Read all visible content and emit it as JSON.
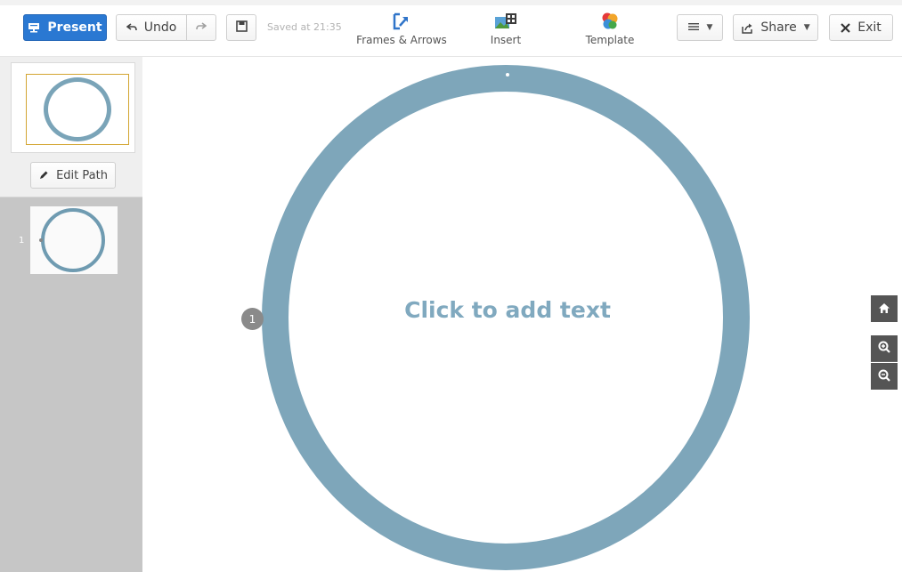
{
  "toolbar": {
    "present_label": "Present",
    "undo_label": "Undo",
    "saved_text": "Saved at 21:35",
    "frames_label": "Frames & Arrows",
    "insert_label": "Insert",
    "template_label": "Template",
    "share_label": "Share",
    "exit_label": "Exit"
  },
  "sidebar": {
    "edit_path_label": "Edit Path",
    "slides": [
      {
        "number": "1"
      }
    ]
  },
  "canvas": {
    "placeholder_text": "Click to add text",
    "step_marker": "1"
  },
  "icons": {
    "present": "presentation-icon",
    "undo": "undo-arrow-icon",
    "redo": "redo-arrow-icon",
    "save": "save-icon",
    "frames": "frames-arrows-icon",
    "insert": "insert-image-icon",
    "template": "template-circles-icon",
    "menu": "hamburger-menu-icon",
    "share": "share-icon",
    "exit": "close-icon",
    "edit_path": "pencil-icon",
    "home": "home-icon",
    "zoom_in": "zoom-in-icon",
    "zoom_out": "zoom-out-icon"
  },
  "colors": {
    "present_button": "#2a78d2",
    "ring": "#7ea6ba",
    "placeholder_text": "#80a9bf",
    "sidebar_bg": "#c6c6c6",
    "thumb_highlight": "#d3a531"
  }
}
